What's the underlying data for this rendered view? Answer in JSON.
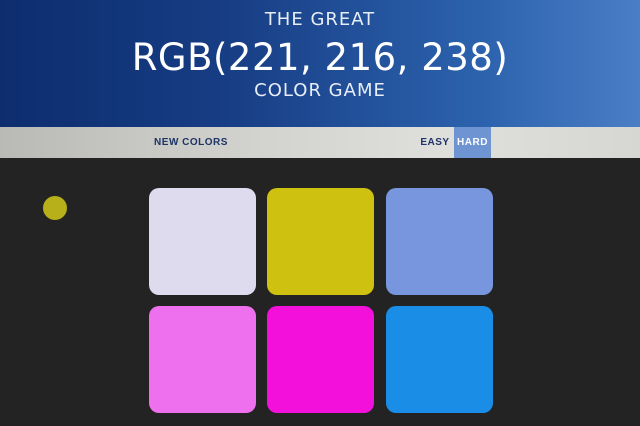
{
  "header": {
    "line1": "THE GREAT",
    "rgb": "RGB(221, 216, 238)",
    "line3": "COLOR GAME"
  },
  "stripe": {
    "new_colors_label": "NEW COLORS",
    "easy_label": "EASY",
    "hard_label": "HARD",
    "active_mode": "hard"
  },
  "status": {
    "dot_color": "#b8b01a"
  },
  "squares": [
    {
      "color": "#dedbef"
    },
    {
      "color": "#cfc10f"
    },
    {
      "color": "#7896de"
    },
    {
      "color": "#ee70ee"
    },
    {
      "color": "#f410db"
    },
    {
      "color": "#1a8ee6"
    }
  ],
  "colors": {
    "header_gradient_start": "#0d2d6e",
    "header_gradient_end": "#4a7fc6",
    "stripe": "#d2d3cf",
    "background": "#232323",
    "active_mode_bg": "#6e95d2",
    "button_text": "#1e3466"
  }
}
